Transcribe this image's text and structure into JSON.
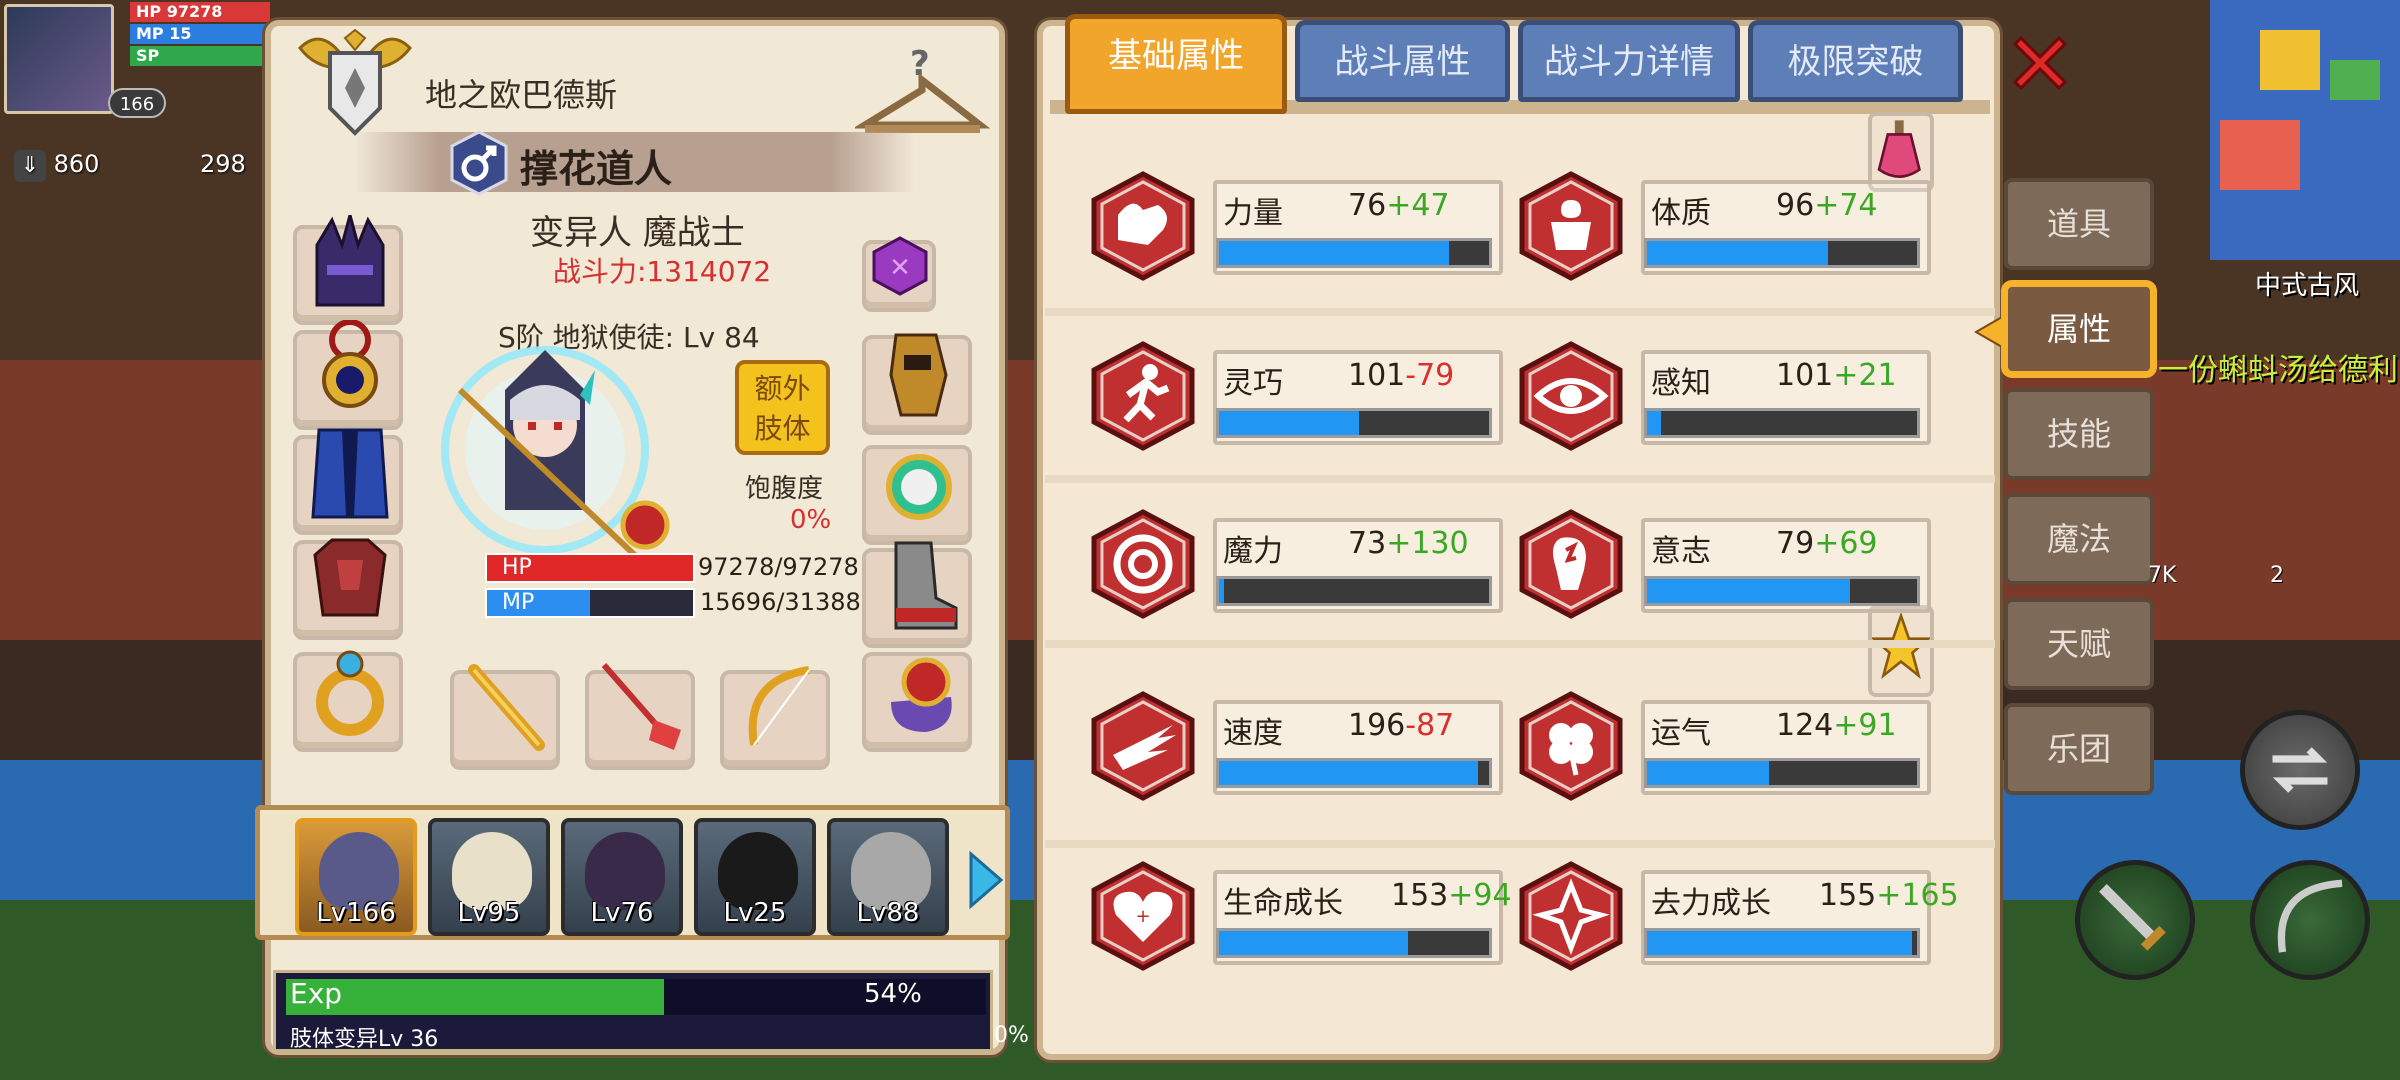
{
  "hud": {
    "bars": [
      "HP",
      "MP",
      "SP"
    ],
    "hp_partial": "97278",
    "mp_partial": "15",
    "level": "166",
    "stat_left": "860",
    "stat_right": "298"
  },
  "character": {
    "title": "地之欧巴德斯",
    "name": "撑花道人",
    "class": "变异人 魔战士",
    "power": "战斗力:1314072",
    "rank": "S阶 地狱使徒: Lv 84",
    "extra_limb_button": "额外肢体",
    "satiety_label": "饱腹度",
    "satiety_value": "0%",
    "hp_label": "HP",
    "mp_label": "MP",
    "hp_text": "97278/97278",
    "mp_text": "15696/31388",
    "hp_fraction": 1.0,
    "mp_fraction": 0.5
  },
  "party": [
    {
      "level": "Lv166",
      "active": true
    },
    {
      "level": "Lv95",
      "active": false
    },
    {
      "level": "Lv76",
      "active": false
    },
    {
      "level": "Lv25",
      "active": false
    },
    {
      "level": "Lv88",
      "active": false
    }
  ],
  "exp": {
    "label": "Exp",
    "percent": "54%",
    "fraction": 0.54,
    "mutation_label": "肢体变异Lv 36",
    "mutation_percent": "0%"
  },
  "tabs": [
    "基础属性",
    "战斗属性",
    "战斗力详情",
    "极限突破"
  ],
  "stats": [
    {
      "name": "力量",
      "base": "76",
      "bonus": "+47",
      "fill": 0.85,
      "icon": "arm-icon"
    },
    {
      "name": "体质",
      "base": "96",
      "bonus": "+74",
      "fill": 0.67,
      "icon": "body-icon"
    },
    {
      "name": "灵巧",
      "base": "101",
      "bonus": "-79",
      "fill": 0.52,
      "icon": "run-icon"
    },
    {
      "name": "感知",
      "base": "101",
      "bonus": "+21",
      "fill": 0.05,
      "icon": "eye-icon"
    },
    {
      "name": "魔力",
      "base": "73",
      "bonus": "+130",
      "fill": 0.02,
      "icon": "swirl-icon"
    },
    {
      "name": "意志",
      "base": "79",
      "bonus": "+69",
      "fill": 0.75,
      "icon": "head-icon"
    },
    {
      "name": "速度",
      "base": "196",
      "bonus": "-87",
      "fill": 0.96,
      "icon": "wing-icon"
    },
    {
      "name": "运气",
      "base": "124",
      "bonus": "+91",
      "fill": 0.45,
      "icon": "clover-icon"
    },
    {
      "name": "生命成长",
      "base": "153",
      "bonus": "+94",
      "fill": 0.7,
      "icon": "heart-icon"
    },
    {
      "name": "去力成长",
      "base": "155",
      "bonus": "+165",
      "fill": 0.98,
      "icon": "star-rune-icon"
    }
  ],
  "side_tabs": [
    "道具",
    "属性",
    "技能",
    "魔法",
    "天赋",
    "乐团"
  ],
  "side_active": 1,
  "world": {
    "area_name": "中式古风",
    "message": "一份蝌蚪汤给德利",
    "gem_k": "7K",
    "gem_count": "2"
  },
  "colors": {
    "tab_active": "#f1a52a",
    "tab_inactive": "#5e7eb8",
    "bar_fill": "#2196f3",
    "bonus_positive": "#3aa824",
    "bonus_negative": "#d83030",
    "power_red": "#d43030",
    "exp_green": "#36b23a"
  }
}
